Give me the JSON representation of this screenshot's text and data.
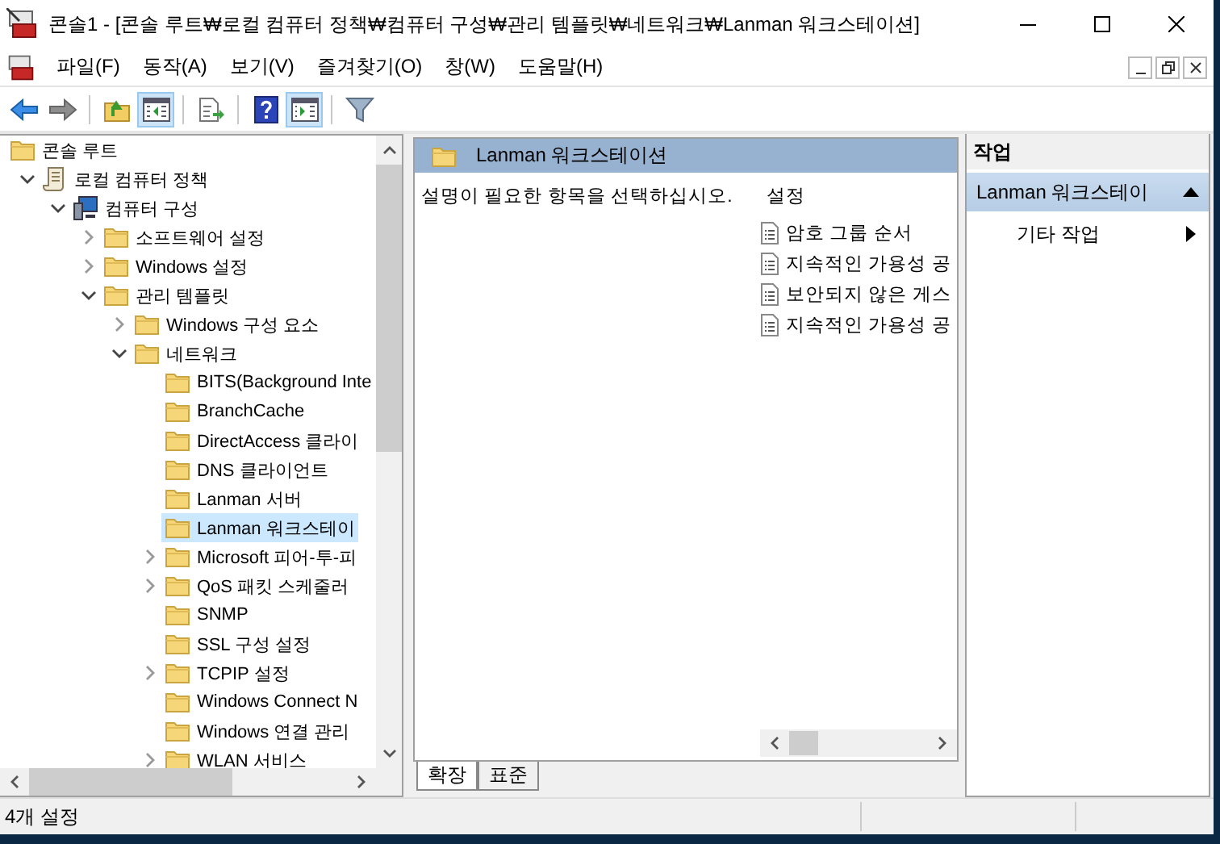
{
  "window": {
    "title": "콘솔1 - [콘솔 루트₩로컬 컴퓨터 정책₩컴퓨터 구성₩관리 템플릿₩네트워크₩Lanman 워크스테이션]"
  },
  "menu": [
    "파일(F)",
    "동작(A)",
    "보기(V)",
    "즐겨찾기(O)",
    "창(W)",
    "도움말(H)"
  ],
  "toolbar": [
    {
      "kind": "back",
      "pressed": false
    },
    {
      "kind": "forward",
      "pressed": false
    },
    {
      "kind": "separator"
    },
    {
      "kind": "up-folder",
      "pressed": false
    },
    {
      "kind": "tree-toggle",
      "pressed": true
    },
    {
      "kind": "separator"
    },
    {
      "kind": "export",
      "pressed": false
    },
    {
      "kind": "separator"
    },
    {
      "kind": "help",
      "pressed": false
    },
    {
      "kind": "pane-toggle",
      "pressed": true
    },
    {
      "kind": "separator"
    },
    {
      "kind": "filter",
      "pressed": false
    }
  ],
  "tree": [
    {
      "label": "콘솔 루트",
      "kind": "folder",
      "selected": false,
      "children": [
        {
          "label": "로컬 컴퓨터 정책",
          "kind": "policy",
          "expanded": true,
          "selected": false,
          "children": [
            {
              "label": "컴퓨터 구성",
              "kind": "computer",
              "expanded": true,
              "selected": false,
              "children": [
                {
                  "label": "소프트웨어 설정",
                  "kind": "folder",
                  "expanded": false,
                  "selected": false
                },
                {
                  "label": "Windows 설정",
                  "kind": "folder",
                  "expanded": false,
                  "selected": false
                },
                {
                  "label": "관리 템플릿",
                  "kind": "folder",
                  "expanded": true,
                  "selected": false,
                  "children": [
                    {
                      "label": "Windows 구성 요소",
                      "kind": "folder",
                      "expanded": false,
                      "selected": false
                    },
                    {
                      "label": "네트워크",
                      "kind": "folder",
                      "expanded": true,
                      "selected": false,
                      "children": [
                        {
                          "label": "BITS(Background Inte",
                          "kind": "folder",
                          "selected": false
                        },
                        {
                          "label": "BranchCache",
                          "kind": "folder",
                          "selected": false
                        },
                        {
                          "label": "DirectAccess 클라이",
                          "kind": "folder",
                          "selected": false
                        },
                        {
                          "label": "DNS 클라이언트",
                          "kind": "folder",
                          "selected": false
                        },
                        {
                          "label": "Lanman 서버",
                          "kind": "folder",
                          "selected": false
                        },
                        {
                          "label": "Lanman 워크스테이",
                          "kind": "folder",
                          "selected": true
                        },
                        {
                          "label": "Microsoft 피어-투-피",
                          "kind": "folder",
                          "expanded": false,
                          "selected": false
                        },
                        {
                          "label": "QoS 패킷 스케줄러",
                          "kind": "folder",
                          "expanded": false,
                          "selected": false
                        },
                        {
                          "label": "SNMP",
                          "kind": "folder",
                          "selected": false
                        },
                        {
                          "label": "SSL 구성 설정",
                          "kind": "folder",
                          "selected": false
                        },
                        {
                          "label": "TCPIP 설정",
                          "kind": "folder",
                          "expanded": false,
                          "selected": false
                        },
                        {
                          "label": "Windows Connect N",
                          "kind": "folder",
                          "selected": false
                        },
                        {
                          "label": "Windows 연결 관리",
                          "kind": "folder",
                          "selected": false
                        },
                        {
                          "label": "WLAN 서비스",
                          "kind": "folder",
                          "expanded": false,
                          "selected": false
                        }
                      ]
                    }
                  ]
                }
              ]
            }
          ]
        }
      ]
    }
  ],
  "content": {
    "title": "Lanman 워크스테이션",
    "description": "설명이 필요한 항목을 선택하십시오.",
    "list_header": "설정",
    "items": [
      "암호 그룹 순서",
      "지속적인 가용성 공",
      "보안되지 않은 게스",
      "지속적인 가용성 공"
    ],
    "tabs": [
      {
        "label": "확장",
        "selected": true
      },
      {
        "label": "표준",
        "selected": false
      }
    ]
  },
  "actions": {
    "title": "작업",
    "section": {
      "label": "Lanman 워크스테이",
      "expanded": true
    },
    "items": [
      "기타 작업"
    ]
  },
  "status_bar": {
    "text": "4개 설정"
  }
}
